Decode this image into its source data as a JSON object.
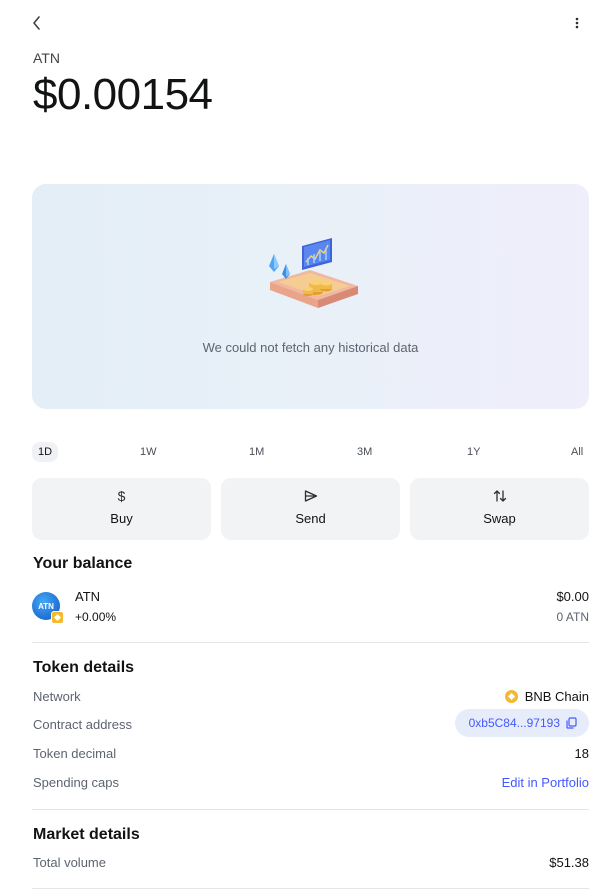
{
  "header": {
    "back_icon": "chevron-left-icon",
    "more_icon": "more-vertical-icon",
    "symbol": "ATN",
    "price": "$0.00154"
  },
  "chart": {
    "empty_message": "We could not fetch any historical data"
  },
  "timeframes": [
    {
      "label": "1D",
      "active": true
    },
    {
      "label": "1W",
      "active": false
    },
    {
      "label": "1M",
      "active": false
    },
    {
      "label": "3M",
      "active": false
    },
    {
      "label": "1Y",
      "active": false
    },
    {
      "label": "All",
      "active": false
    }
  ],
  "actions": {
    "buy": {
      "label": "Buy",
      "icon": "dollar-icon"
    },
    "send": {
      "label": "Send",
      "icon": "send-icon"
    },
    "swap": {
      "label": "Swap",
      "icon": "swap-icon"
    }
  },
  "balance": {
    "title": "Your balance",
    "token_avatar_text": "ATN",
    "token_name": "ATN",
    "change": "+0.00%",
    "fiat_value": "$0.00",
    "amount": "0 ATN"
  },
  "token_details": {
    "title": "Token details",
    "network_label": "Network",
    "network_value": "BNB Chain",
    "contract_label": "Contract address",
    "contract_value": "0xb5C84...97193",
    "decimal_label": "Token decimal",
    "decimal_value": "18",
    "spending_label": "Spending caps",
    "spending_value": "Edit in Portfolio"
  },
  "market_details": {
    "title": "Market details",
    "volume_label": "Total volume",
    "volume_value": "$51.38"
  },
  "colors": {
    "accent": "#4459ff",
    "bnb": "#f3ba2f",
    "muted_text": "#5d6470"
  }
}
